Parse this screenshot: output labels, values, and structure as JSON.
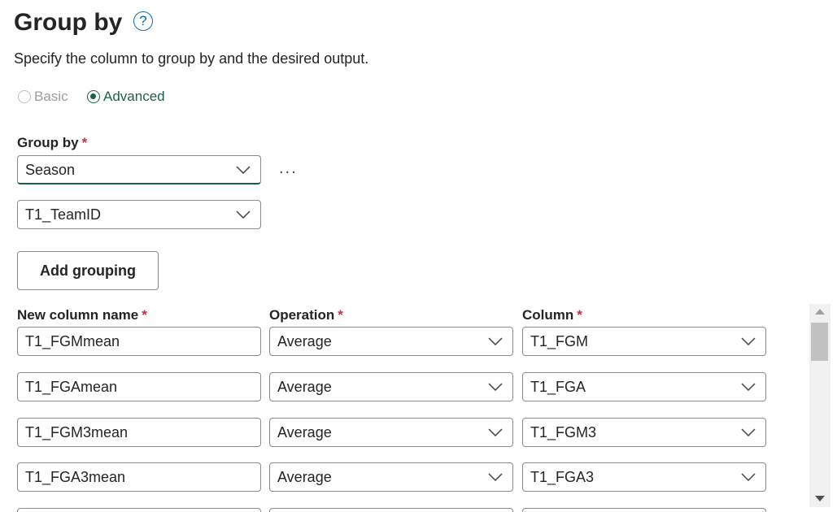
{
  "header": {
    "title": "Group by",
    "help_icon": "?",
    "subtitle": "Specify the column to group by and the desired output."
  },
  "mode": {
    "basic_label": "Basic",
    "advanced_label": "Advanced",
    "selected": "Advanced"
  },
  "group_by": {
    "label": "Group by",
    "required_mark": "*",
    "fields": [
      "Season",
      "T1_TeamID"
    ],
    "more_label": "...",
    "add_grouping_label": "Add grouping"
  },
  "aggregations": {
    "headers": {
      "new_column_name": "New column name",
      "operation": "Operation",
      "column": "Column",
      "required_mark": "*"
    },
    "rows": [
      {
        "name": "T1_FGMmean",
        "operation": "Average",
        "column": "T1_FGM"
      },
      {
        "name": "T1_FGAmean",
        "operation": "Average",
        "column": "T1_FGA"
      },
      {
        "name": "T1_FGM3mean",
        "operation": "Average",
        "column": "T1_FGM3"
      },
      {
        "name": "T1_FGA3mean",
        "operation": "Average",
        "column": "T1_FGA3"
      }
    ]
  },
  "colors": {
    "accent": "#1b5e4a",
    "help": "#0f6cbd",
    "required": "#c4314b",
    "border": "#8a8a8a"
  }
}
